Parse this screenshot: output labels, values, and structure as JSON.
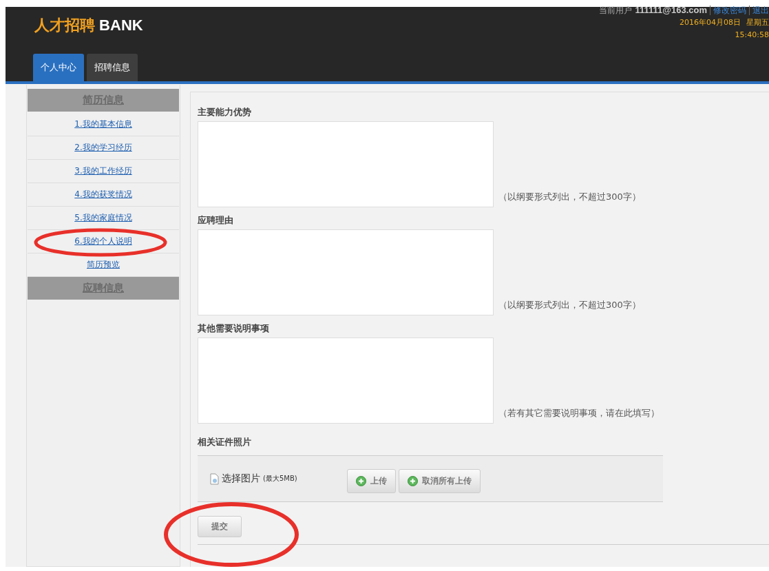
{
  "header": {
    "brand": "人才招聘",
    "brand_suffix": "BANK",
    "user_label": "当前用户",
    "user": "111111@163.com",
    "links": [
      "修改密码",
      "退出"
    ],
    "date": "2016年04月08日",
    "weekday": "星期五",
    "time": "15:40:58"
  },
  "tabs": [
    {
      "label": "个人中心",
      "selected": true
    },
    {
      "label": "招聘信息",
      "selected": false
    }
  ],
  "sidebar": [
    {
      "title": "简历信息",
      "items": [
        "1.我的基本信息",
        "2.我的学习经历",
        "3.我的工作经历",
        "4.我的获奖情况",
        "5.我的家庭情况",
        "6.我的个人说明",
        "简历预览"
      ]
    },
    {
      "title": "应聘信息"
    }
  ],
  "fields": [
    {
      "label": "主要能力优势",
      "hint": "（以纲要形式列出，不超过300字）"
    },
    {
      "label": "应聘理由",
      "hint": "（以纲要形式列出，不超过300字）"
    },
    {
      "label": "其他需要说明事项",
      "hint": "（若有其它需要说明事项，请在此填写）"
    }
  ],
  "upload": {
    "label": "相关证件照片",
    "file_button": "选择图片",
    "limit": "(最大5MB)",
    "buttons": [
      "上传",
      "取消所有上传"
    ]
  },
  "submit": "提交"
}
